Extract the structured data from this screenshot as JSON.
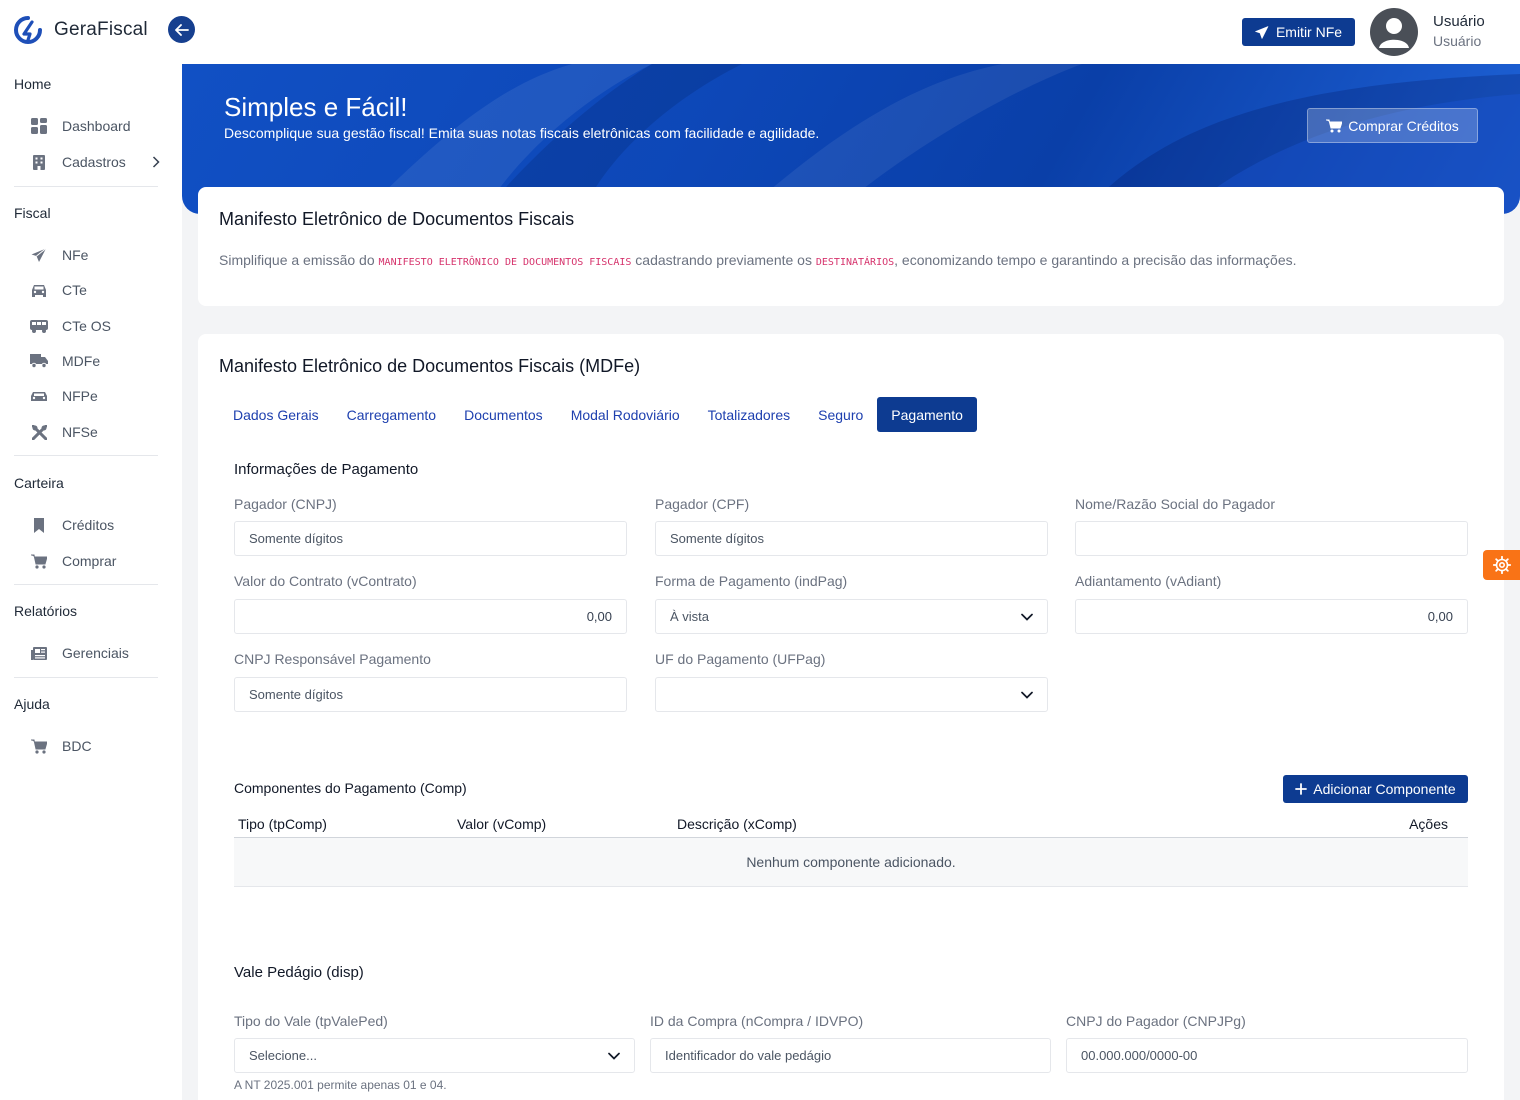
{
  "app": {
    "name": "GeraFiscal"
  },
  "header": {
    "emit_label": "Emitir NFe",
    "user_name": "Usuário",
    "user_role": "Usuário"
  },
  "sidebar": {
    "sections": [
      {
        "title": "Home",
        "items": [
          {
            "label": "Dashboard",
            "icon": "dashboard-icon"
          },
          {
            "label": "Cadastros",
            "icon": "building-icon"
          }
        ]
      },
      {
        "title": "Fiscal",
        "items": [
          {
            "label": "NFe",
            "icon": "paper-plane-icon"
          },
          {
            "label": "CTe",
            "icon": "car-icon"
          },
          {
            "label": "CTe OS",
            "icon": "bus-icon"
          },
          {
            "label": "MDFe",
            "icon": "truck-icon"
          },
          {
            "label": "NFPe",
            "icon": "taxi-icon"
          },
          {
            "label": "NFSe",
            "icon": "tools-icon"
          }
        ]
      },
      {
        "title": "Carteira",
        "items": [
          {
            "label": "Créditos",
            "icon": "bookmark-icon"
          },
          {
            "label": "Comprar",
            "icon": "cart-icon"
          }
        ]
      },
      {
        "title": "Relatórios",
        "items": [
          {
            "label": "Gerenciais",
            "icon": "newspaper-icon"
          }
        ]
      },
      {
        "title": "Ajuda",
        "items": [
          {
            "label": "BDC",
            "icon": "cart-icon"
          }
        ]
      }
    ]
  },
  "banner": {
    "title": "Simples e Fácil!",
    "subtitle": "Descomplique sua gestão fiscal! Emita suas notas fiscais eletrônicas com facilidade e agilidade.",
    "buy_label": "Comprar Créditos"
  },
  "intro": {
    "title": "Manifesto Eletrônico de Documentos Fiscais",
    "text_pre": "Simplifique a emissão do ",
    "code1": "MANIFESTO ELETRÔNICO DE DOCUMENTOS FISCAIS",
    "text_mid": " cadastrando previamente os ",
    "code2": "DESTINATÁRIOS",
    "text_post": ", economizando tempo e garantindo a precisão das informações."
  },
  "form": {
    "title": "Manifesto Eletrônico de Documentos Fiscais (MDFe)",
    "tabs": [
      "Dados Gerais",
      "Carregamento",
      "Documentos",
      "Modal Rodoviário",
      "Totalizadores",
      "Seguro",
      "Pagamento"
    ],
    "active_tab": "Pagamento",
    "payment": {
      "section_title": "Informações de Pagamento",
      "pagador_cnpj": {
        "label": "Pagador (CNPJ)",
        "placeholder": "Somente dígitos"
      },
      "pagador_cpf": {
        "label": "Pagador (CPF)",
        "placeholder": "Somente dígitos"
      },
      "nome_pagador": {
        "label": "Nome/Razão Social do Pagador",
        "value": ""
      },
      "valor_contrato": {
        "label": "Valor do Contrato (vContrato)",
        "value": "0,00"
      },
      "forma_pagamento": {
        "label": "Forma de Pagamento (indPag)",
        "value": "À vista"
      },
      "adiantamento": {
        "label": "Adiantamento (vAdiant)",
        "value": "0,00"
      },
      "cnpj_responsavel": {
        "label": "CNPJ Responsável Pagamento",
        "placeholder": "Somente dígitos"
      },
      "uf_pagamento": {
        "label": "UF do Pagamento (UFPag)",
        "value": ""
      }
    },
    "components": {
      "title": "Componentes do Pagamento (Comp)",
      "add_label": "Adicionar Componente",
      "columns": [
        "Tipo (tpComp)",
        "Valor (vComp)",
        "Descrição (xComp)",
        "Ações"
      ],
      "empty_text": "Nenhum componente adicionado."
    },
    "vale": {
      "title": "Vale Pedágio (disp)",
      "tipo": {
        "label": "Tipo do Vale (tpValePed)",
        "placeholder": "Selecione..."
      },
      "id_compra": {
        "label": "ID da Compra (nCompra / IDVPO)",
        "placeholder": "Identificador do vale pedágio"
      },
      "cnpj_pagador": {
        "label": "CNPJ do Pagador (CNPJPg)",
        "placeholder": "00.000.000/0000-00"
      },
      "hint": "A NT 2025.001 permite apenas 01 e 04."
    }
  },
  "colors": {
    "primary": "#0d3b91",
    "accent": "#f97316",
    "code": "#d6336c"
  }
}
